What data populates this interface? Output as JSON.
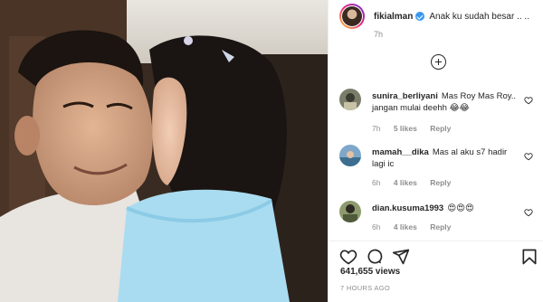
{
  "post": {
    "username": "fikialman",
    "caption": "Anak ku sudah besar .. ..",
    "time": "7h"
  },
  "comments": [
    {
      "user": "sunira_berliyani",
      "text": "Mas Roy Mas Roy.. jangan mulai deehh 😂😂",
      "time": "7h",
      "likes": "5 likes",
      "reply": "Reply"
    },
    {
      "user": "mamah__dika",
      "text": "Mas al aku s7 hadir lagi ic",
      "time": "6h",
      "likes": "4 likes",
      "reply": "Reply"
    },
    {
      "user": "dian.kusuma1993",
      "text": "😍😍😍",
      "time": "6h",
      "likes": "4 likes",
      "reply": "Reply"
    }
  ],
  "stats": {
    "views": "641,655 views",
    "posted": "7 HOURS AGO"
  },
  "icons": {
    "like": "heart-outline-icon",
    "comment": "comment-bubble-icon",
    "share": "paper-plane-icon",
    "save": "bookmark-icon",
    "load_more": "plus-circle-icon",
    "verified": "verified-badge-icon"
  },
  "colors": {
    "verified": "#3897f0",
    "muted": "#8e8e8e",
    "text": "#262626"
  }
}
